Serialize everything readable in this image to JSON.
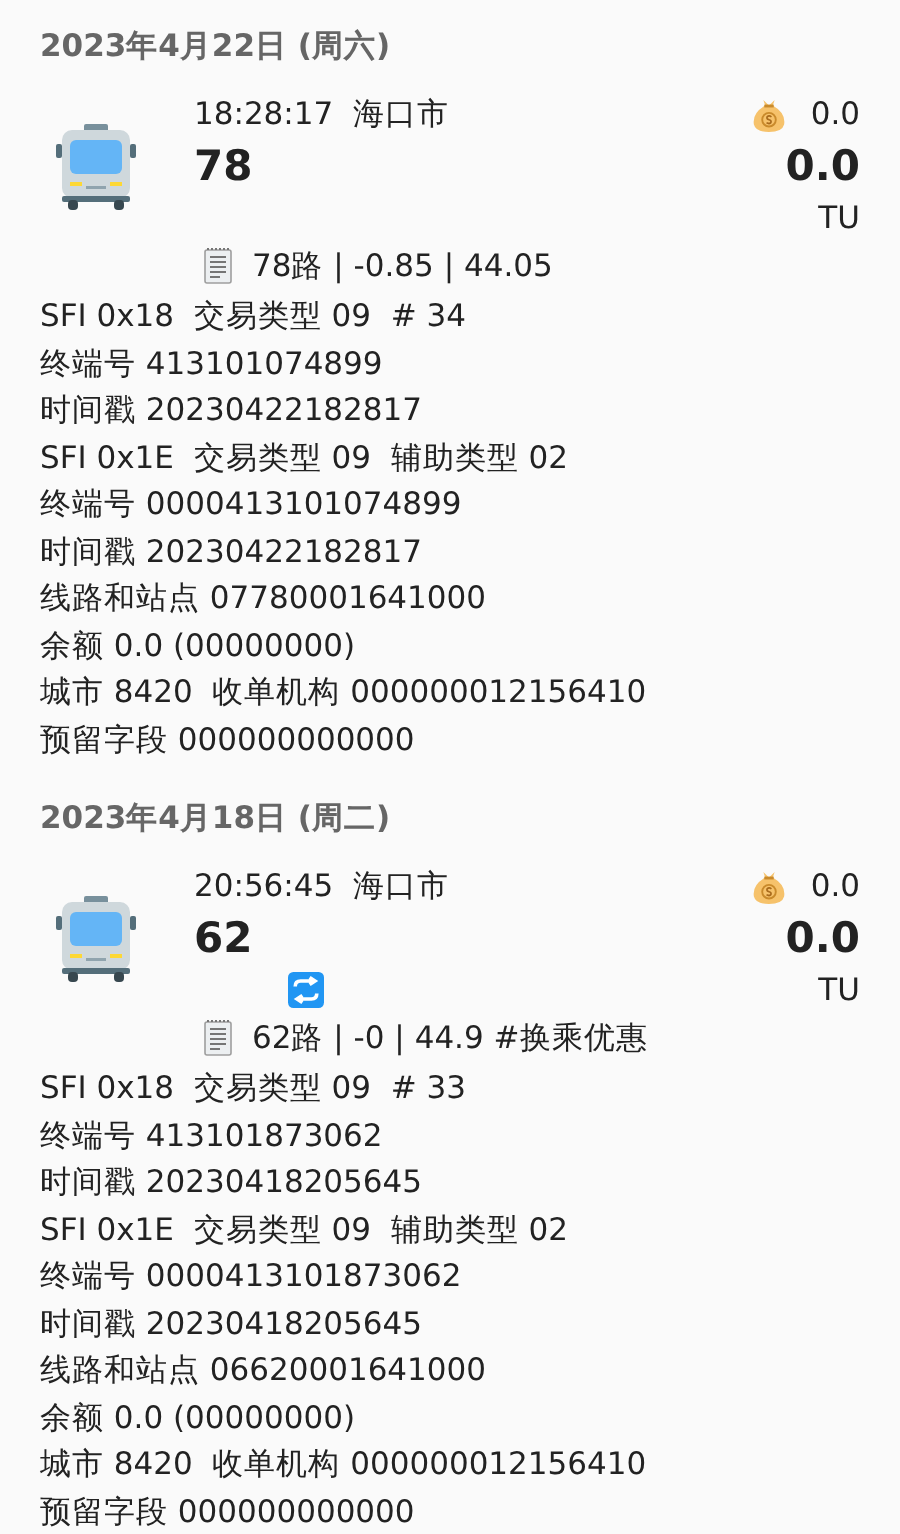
{
  "records": [
    {
      "date": "2023年4月22日 (周六)",
      "time": "18:28:17",
      "city": "海口市",
      "route_number": "78",
      "amount": "0.0",
      "balance": "0.0",
      "unit": "TU",
      "transfer": false,
      "summary": "78路 | -0.85 | 44.05",
      "details": [
        "SFI 0x18  交易类型 09  # 34",
        "终端号 413101074899",
        "时间戳 20230422182817",
        "SFI 0x1E  交易类型 09  辅助类型 02",
        "终端号 0000413101074899",
        "时间戳 20230422182817",
        "线路和站点 07780001641000",
        "余额 0.0 (00000000)",
        "城市 8420  收单机构 000000012156410",
        "预留字段 000000000000"
      ]
    },
    {
      "date": "2023年4月18日 (周二)",
      "time": "20:56:45",
      "city": "海口市",
      "route_number": "62",
      "amount": "0.0",
      "balance": "0.0",
      "unit": "TU",
      "transfer": true,
      "summary": "62路 | -0 | 44.9 #换乘优惠",
      "details": [
        "SFI 0x18  交易类型 09  # 33",
        "终端号 413101873062",
        "时间戳 20230418205645",
        "SFI 0x1E  交易类型 09  辅助类型 02",
        "终端号 0000413101873062",
        "时间戳 20230418205645",
        "线路和站点 06620001641000",
        "余额 0.0 (00000000)",
        "城市 8420  收单机构 000000012156410",
        "预留字段 000000000000"
      ]
    }
  ]
}
